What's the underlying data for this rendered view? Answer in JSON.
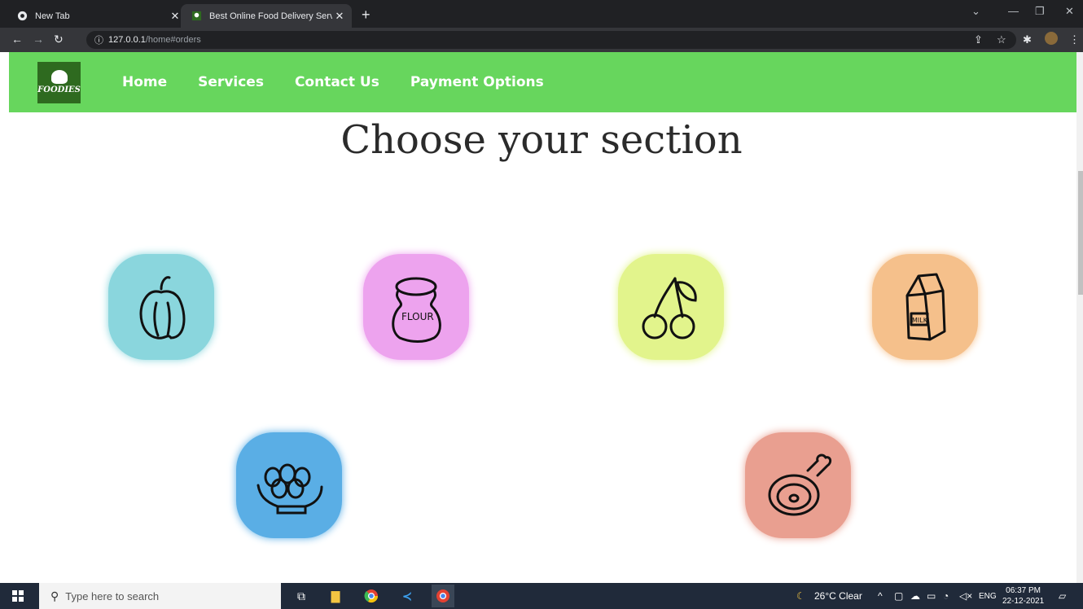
{
  "browser": {
    "tabs": [
      {
        "title": "New Tab",
        "active": false
      },
      {
        "title": "Best Online Food Delivery Servic",
        "active": true
      }
    ],
    "new_tab_label": "+",
    "url_host": "127.0.0.1",
    "url_path": "/home#orders"
  },
  "site": {
    "logo_text": "FOODIES",
    "nav": [
      {
        "label": "Home"
      },
      {
        "label": "Services"
      },
      {
        "label": "Contact Us"
      },
      {
        "label": "Payment Options"
      }
    ],
    "heading": "Choose your section",
    "sections": [
      {
        "name": "pepper",
        "color": "#8ad6dd"
      },
      {
        "name": "flour",
        "label": "FLOUR",
        "color": "#eda3ee"
      },
      {
        "name": "cherry",
        "color": "#e2f48c"
      },
      {
        "name": "milk",
        "label": "MILK",
        "color": "#f5c08b"
      },
      {
        "name": "eggs",
        "color": "#5aaee5"
      },
      {
        "name": "meat",
        "color": "#e99f90"
      }
    ],
    "accent_color": "#67d65d"
  },
  "taskbar": {
    "search_placeholder": "Type here to search",
    "weather": "26°C  Clear",
    "language": "ENG",
    "time": "06:37 PM",
    "date": "22-12-2021"
  }
}
